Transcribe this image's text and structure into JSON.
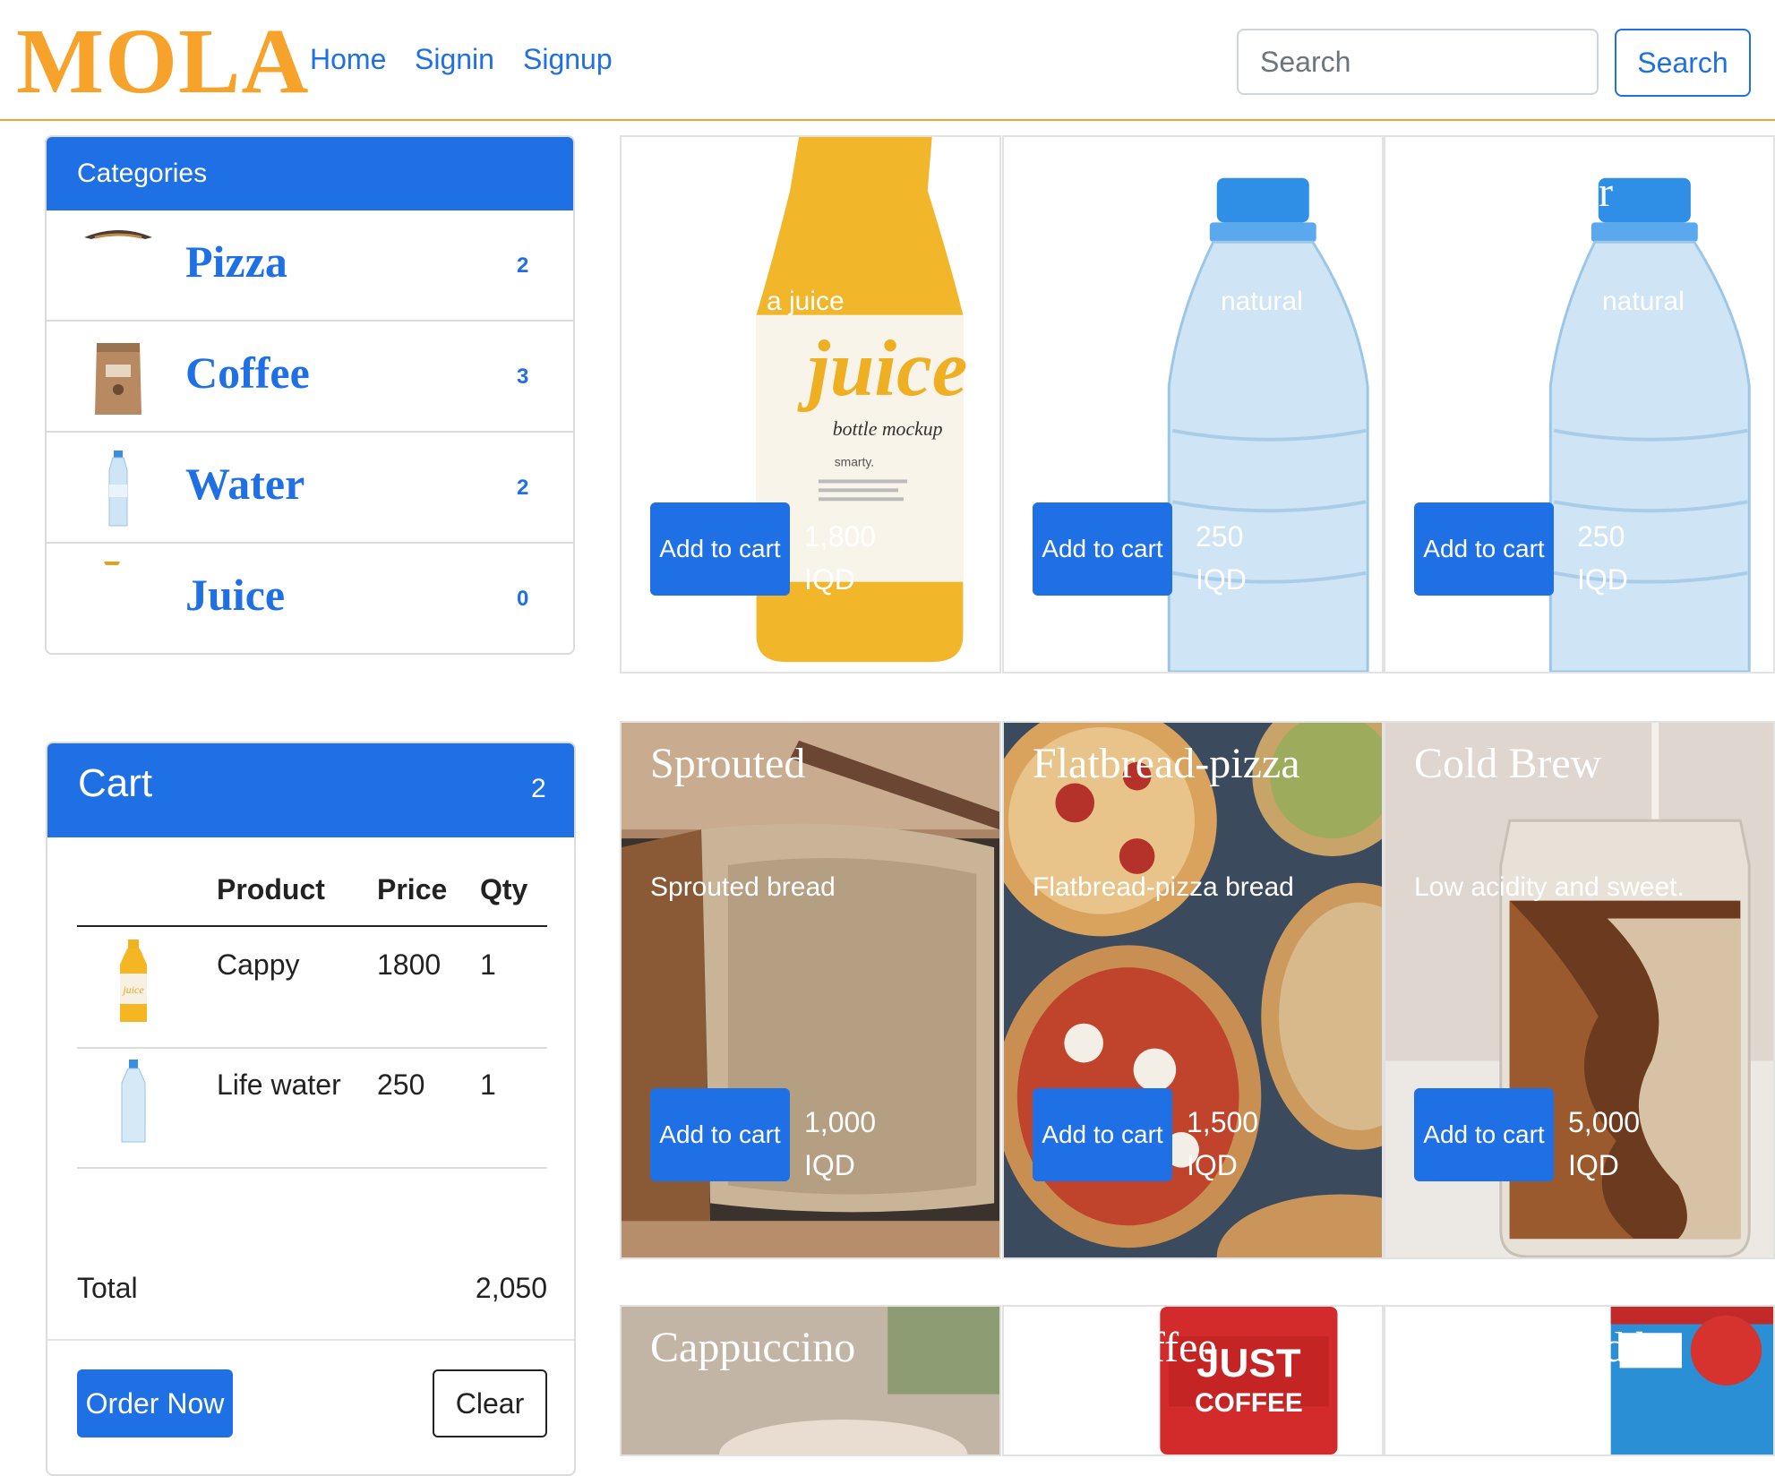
{
  "nav": {
    "brand": "MOLA",
    "links": [
      "Home",
      "Signin",
      "Signup"
    ],
    "search_placeholder": "Search",
    "search_button": "Search"
  },
  "categories": {
    "title": "Categories",
    "items": [
      {
        "name": "Pizza",
        "count": "2"
      },
      {
        "name": "Coffee",
        "count": "3"
      },
      {
        "name": "Water",
        "count": "2"
      },
      {
        "name": "Juice",
        "count": "0"
      }
    ]
  },
  "cart": {
    "title": "Cart",
    "count": "2",
    "columns": [
      "Product",
      "Price",
      "Qty"
    ],
    "rows": [
      {
        "product": "Cappy",
        "price": "1800",
        "qty": "1"
      },
      {
        "product": "Life water",
        "price": "250",
        "qty": "1"
      }
    ],
    "total_label": "Total",
    "total_value": "2,050",
    "order_button": "Order Now",
    "clear_button": "Clear"
  },
  "products": [
    {
      "title": "",
      "desc": "a juice",
      "add": "Add to cart",
      "price": "1,800",
      "currency": "IQD"
    },
    {
      "title": "",
      "desc": "natural",
      "add": "Add to cart",
      "price": "250",
      "currency": "IQD"
    },
    {
      "title": "r",
      "desc": "natural",
      "add": "Add to cart",
      "price": "250",
      "currency": "IQD"
    },
    {
      "title": "Sprouted",
      "desc": "Sprouted bread",
      "add": "Add to cart",
      "price": "1,000",
      "currency": "IQD"
    },
    {
      "title": "Flatbread-pizza",
      "desc": "Flatbread-pizza bread",
      "add": "Add to cart",
      "price": "1,500",
      "currency": "IQD"
    },
    {
      "title": "Cold Brew",
      "desc": "Low acidity and sweet.",
      "add": "Add to cart",
      "price": "5,000",
      "currency": "IQD"
    },
    {
      "title": "Cappuccino",
      "desc": "",
      "add": "",
      "price": "",
      "currency": ""
    },
    {
      "title": "ffee",
      "desc": "",
      "add": "",
      "price": "",
      "currency": ""
    },
    {
      "title": "id h",
      "desc": "",
      "add": "",
      "price": "",
      "currency": ""
    }
  ],
  "colors": {
    "primary": "#1f6fe5",
    "brand": "#f7a32b"
  }
}
